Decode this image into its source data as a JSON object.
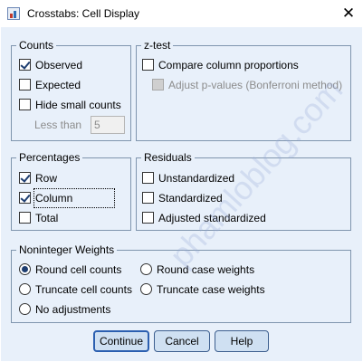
{
  "window": {
    "title": "Crosstabs: Cell Display",
    "close_glyph": "✕"
  },
  "counts": {
    "legend": "Counts",
    "observed": {
      "label": "Observed",
      "checked": true
    },
    "expected": {
      "label": "Expected",
      "checked": false
    },
    "hide_small": {
      "label": "Hide small counts",
      "checked": false
    },
    "less_than": {
      "label": "Less than",
      "value": "5"
    }
  },
  "ztest": {
    "legend": "z-test",
    "compare": {
      "label": "Compare column proportions",
      "checked": false
    },
    "adjust": {
      "label": "Adjust p-values (Bonferroni method)",
      "checked": false,
      "disabled": true
    }
  },
  "percentages": {
    "legend": "Percentages",
    "row": {
      "label": "Row",
      "checked": true
    },
    "column": {
      "label": "Column",
      "checked": true
    },
    "total": {
      "label": "Total",
      "checked": false
    }
  },
  "residuals": {
    "legend": "Residuals",
    "unstandardized": {
      "label": "Unstandardized",
      "checked": false
    },
    "standardized": {
      "label": "Standardized",
      "checked": false
    },
    "adjusted": {
      "label": "Adjusted standardized",
      "checked": false
    }
  },
  "weights": {
    "legend": "Noninteger Weights",
    "round_cell": {
      "label": "Round cell counts",
      "selected": true
    },
    "round_case": {
      "label": "Round case weights",
      "selected": false
    },
    "truncate_cell": {
      "label": "Truncate cell counts",
      "selected": false
    },
    "truncate_case": {
      "label": "Truncate case weights",
      "selected": false
    },
    "no_adjust": {
      "label": "No adjustments",
      "selected": false
    }
  },
  "buttons": {
    "continue": "Continue",
    "cancel": "Cancel",
    "help": "Help"
  },
  "watermark": "phamloblog.com",
  "colors": {
    "dialog_bg": "#e8f0fa",
    "group_border": "#7f95ae",
    "button_bg": "#cfe0f2",
    "check_mark": "#1d3d70",
    "default_button_border": "#2b5fb0"
  }
}
